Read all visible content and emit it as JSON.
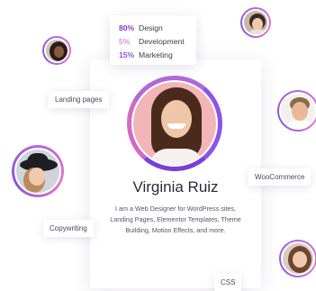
{
  "profile": {
    "name": "Virginia Ruiz",
    "bio": "I am a Web Designer for WordPress sites, Landing Pages, Elementor Templates, Theme Building, Motion Effects, and more."
  },
  "skills": [
    {
      "pct": "80%",
      "name": "Design",
      "color": "#7b3fd6"
    },
    {
      "pct": "5%",
      "name": "Development",
      "color": "#d06bc4"
    },
    {
      "pct": "15%",
      "name": "Marketing",
      "color": "#8a55e6"
    }
  ],
  "tags": {
    "landing_pages": "Landing pages",
    "woocommerce": "WooCommerce",
    "copywriting": "Copywriting",
    "css": "CSS"
  },
  "colors": {
    "accent_purple": "#7b3fd6",
    "accent_pink": "#d06bc4",
    "photo_bg": "#f3b6b8"
  }
}
